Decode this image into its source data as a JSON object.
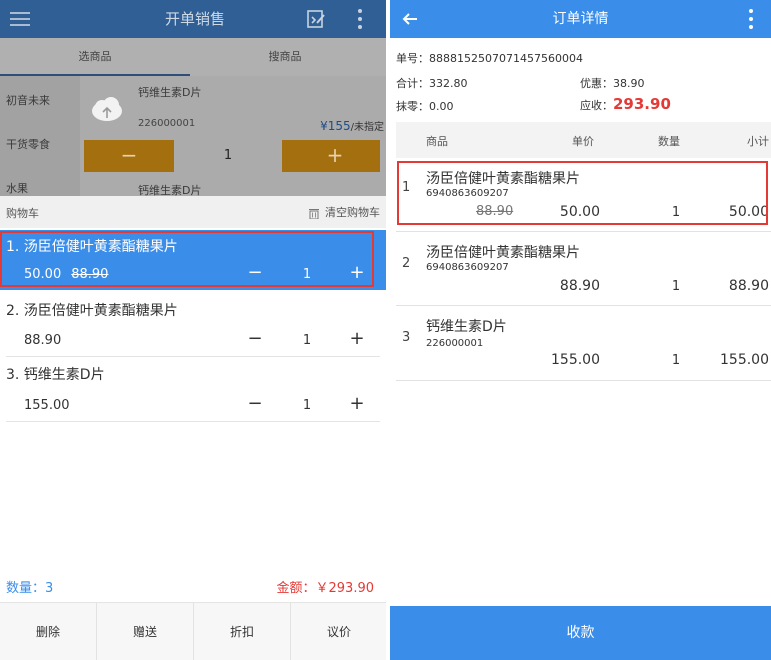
{
  "left": {
    "title": "开单销售",
    "tabs": [
      "选商品",
      "搜商品"
    ],
    "categories": [
      "初音未来",
      "干货零食",
      "水果"
    ],
    "product": {
      "name": "钙维生素D片",
      "code": "226000001",
      "price": "¥155",
      "price_note": "/未指定",
      "qty": "1",
      "minus": "−",
      "plus": "+"
    },
    "product_next": {
      "name": "钙维生素D片"
    },
    "cart": {
      "label": "购物车",
      "clear_label": "清空购物车",
      "items": [
        {
          "name": "1. 汤臣倍健叶黄素酯糖果片",
          "price": "50.00",
          "orig": "88.90",
          "minus": "−",
          "qty": "1",
          "plus": "+"
        },
        {
          "name": "2. 汤臣倍健叶黄素酯糖果片",
          "price": "88.90",
          "minus": "−",
          "qty": "1",
          "plus": "+"
        },
        {
          "name": "3. 钙维生素D片",
          "price": "155.00",
          "minus": "−",
          "qty": "1",
          "plus": "+"
        }
      ]
    },
    "summary": {
      "count": "数量：3",
      "amount": "金额：￥293.90"
    },
    "actions": [
      "删除",
      "赠送",
      "折扣",
      "议价"
    ]
  },
  "right": {
    "title": "订单详情",
    "order": {
      "no_label": "单号：",
      "no": "8888152507071457560004",
      "total_label": "合计：",
      "total": "332.80",
      "discount_label": "优惠：",
      "discount": "38.90",
      "rounding_label": "抹零：",
      "rounding": "0.00",
      "due_label": "应收：",
      "due": "293.90"
    },
    "columns": [
      "商品",
      "单价",
      "数量",
      "小计"
    ],
    "rows": [
      {
        "idx": "1",
        "name": "汤臣倍健叶黄素酯糖果片",
        "barcode": "6940863609207",
        "orig": "88.90",
        "unit": "50.00",
        "qty": "1",
        "subtotal": "50.00"
      },
      {
        "idx": "2",
        "name": "汤臣倍健叶黄素酯糖果片",
        "barcode": "6940863609207",
        "unit": "88.90",
        "qty": "1",
        "subtotal": "88.90"
      },
      {
        "idx": "3",
        "name": "钙维生素D片",
        "barcode": "226000001",
        "unit": "155.00",
        "qty": "1",
        "subtotal": "155.00"
      }
    ],
    "pay_label": "收款"
  },
  "colors": {
    "primary": "#3a8eea",
    "dark_bar": "#2f5f95",
    "red": "#e53935",
    "orange": "#a36f0f"
  }
}
